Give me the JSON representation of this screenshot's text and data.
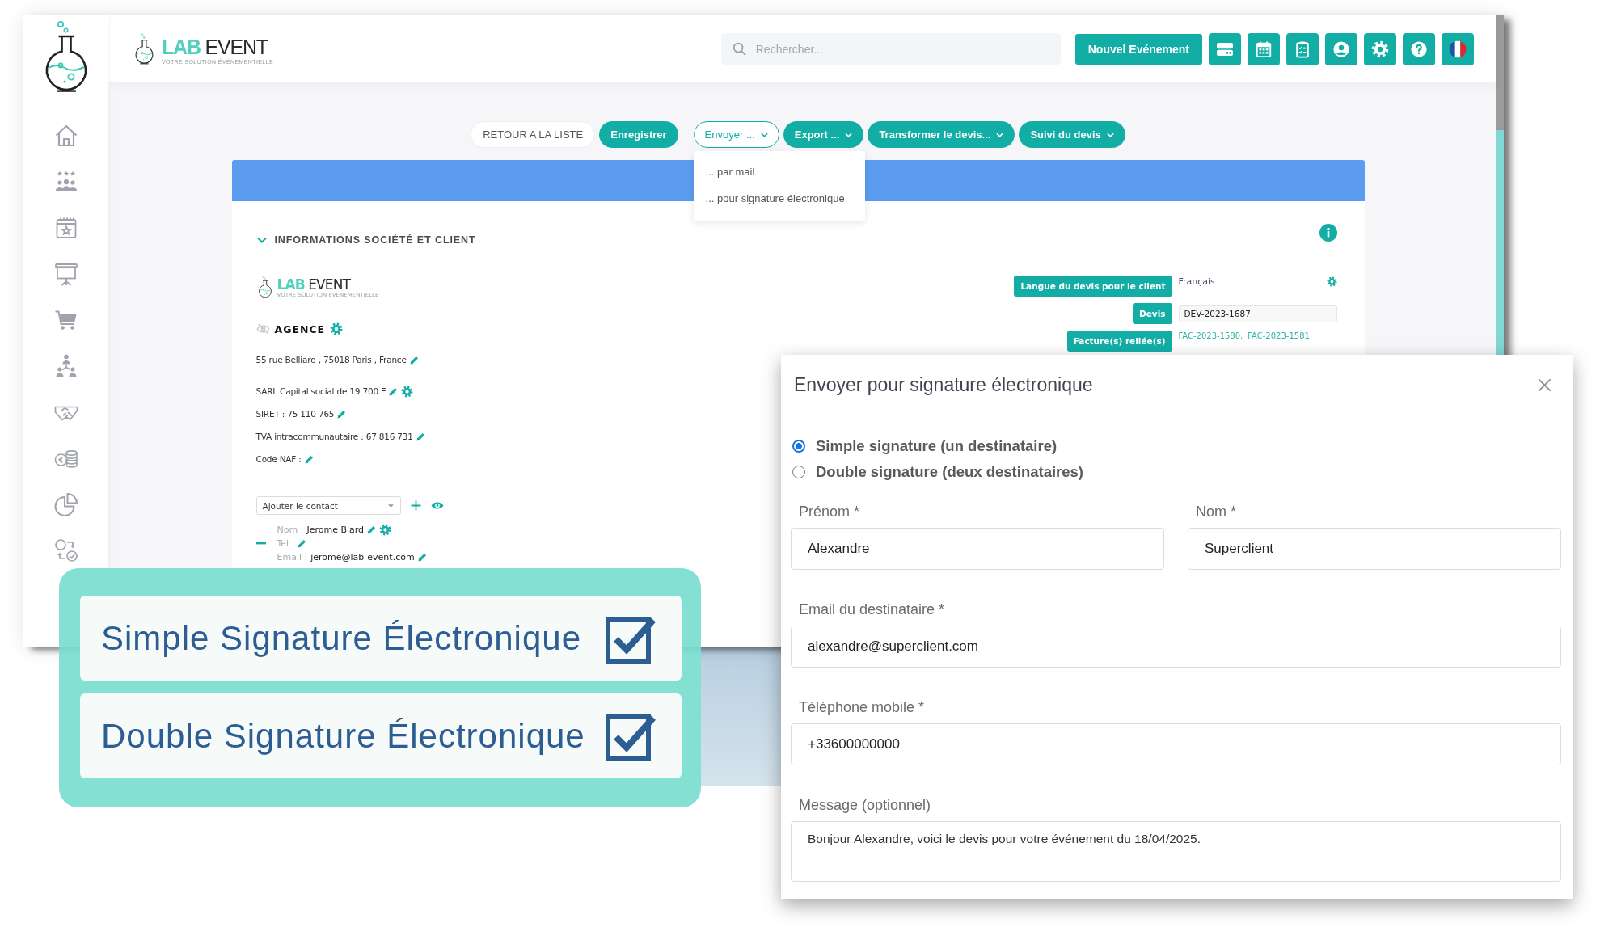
{
  "header": {
    "logo": {
      "accent": "LAB",
      "name": "EVENT",
      "tagline": "VOTRE SOLUTION ÉVÉNEMENTIELLE"
    },
    "search": {
      "placeholder": "Rechercher..."
    },
    "new_event_button": "Nouvel Evénement"
  },
  "toolbar": {
    "buttons": [
      {
        "label": "RETOUR A LA LISTE",
        "kind": "plain",
        "expanded": false
      },
      {
        "label": "Enregistrer",
        "kind": "primary",
        "expanded": false
      },
      {
        "label": "Envoyer ...",
        "kind": "menu",
        "expanded": true,
        "menu": [
          "... par mail",
          "... pour signature électronique"
        ]
      },
      {
        "label": "Export ...",
        "kind": "menu",
        "expanded": false
      },
      {
        "label": "Transformer le devis...",
        "kind": "menu",
        "expanded": false
      },
      {
        "label": "Suivi du devis",
        "kind": "menu",
        "expanded": false
      }
    ]
  },
  "section": {
    "title": "INFORMATIONS SOCIÉTÉ ET CLIENT",
    "expanded": true
  },
  "company": {
    "logo": {
      "accent": "LAB",
      "name": "EVENT",
      "tagline": "VOTRE SOLUTION ÉVÉNEMENTIELLE"
    },
    "name": "AGENCE",
    "lines": [
      {
        "text": "55 rue Belliard , 75018 Paris , France",
        "kind": "edit"
      },
      {
        "text": "SARL Capital social de 19 700 E",
        "kind": "edit_settings"
      },
      {
        "text": "SIRET : 75 110 765",
        "kind": "edit"
      },
      {
        "text": "TVA intracommunautaire : 67 816 731",
        "kind": "edit"
      },
      {
        "text": "Code NAF :",
        "kind": "edit"
      }
    ]
  },
  "contact": {
    "select": "Ajouter le contact",
    "fields": [
      {
        "label": "Nom :",
        "value": "Jerome Biard",
        "kind": "edit_settings"
      },
      {
        "label": "Tel :",
        "kind": "edit"
      },
      {
        "label": "Email :",
        "value": "jerome@lab-event.com",
        "kind": "edit"
      }
    ]
  },
  "quote_info": {
    "rows": [
      {
        "label": "Langue du devis pour le client",
        "kind": "setting",
        "value": "Français"
      },
      {
        "label": "Devis",
        "kind": "input",
        "value": "DEV-2023-1687"
      },
      {
        "label": "Facture(s) reliée(s)",
        "kind": "links",
        "links": [
          "FAC-2023-1580,",
          "FAC-2023-1581"
        ]
      }
    ]
  },
  "overlay": {
    "features": [
      {
        "label": "Simple Signature Électronique",
        "checked": true
      },
      {
        "label": "Double Signature Électronique",
        "checked": true
      }
    ]
  },
  "modal": {
    "title": "Envoyer pour signature électronique",
    "options": [
      {
        "label": "Simple signature (un destinataire)",
        "selected": true
      },
      {
        "label": "Double signature (deux destinataires)",
        "selected": false
      }
    ],
    "fields": [
      {
        "label": "Prénom *",
        "value": "Alexandre",
        "kind": "half"
      },
      {
        "label": "Nom *",
        "value": "Superclient",
        "kind": "half"
      },
      {
        "label": "Email du destinataire *",
        "value": "alexandre@superclient.com",
        "kind": "full"
      },
      {
        "label": "Téléphone mobile *",
        "value": "+33600000000",
        "kind": "full"
      },
      {
        "label": "Message (optionnel)",
        "value": "Bonjour Alexandre, voici le devis pour votre événement du 18/04/2025.",
        "kind": "textarea"
      }
    ]
  }
}
